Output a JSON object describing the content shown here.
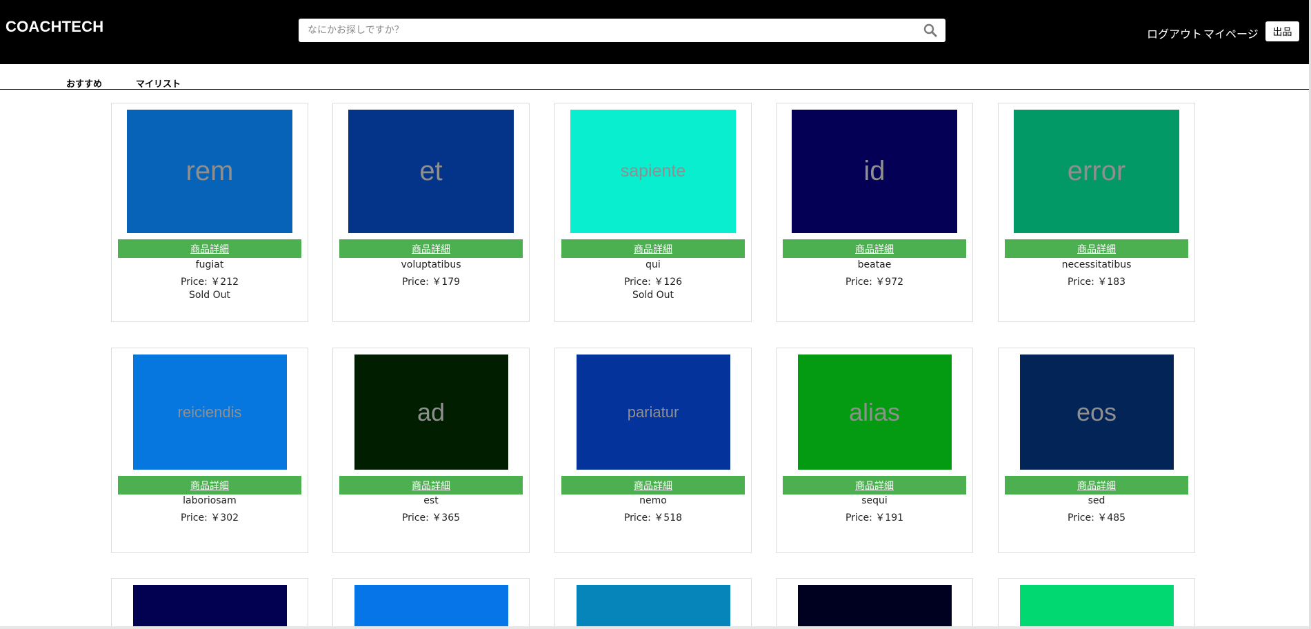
{
  "header": {
    "logo": "COACHTECH",
    "search_placeholder": "なにかお探しですか？",
    "logout": "ログアウト",
    "mypage": "マイページ",
    "post": "出品"
  },
  "tabs": [
    "おすすめ",
    "マイリスト"
  ],
  "detail_label": "商品詳細",
  "price_prefix": "Price: ￥",
  "sold_label": "Sold Out",
  "items": [
    {
      "thumb_text": "rem",
      "color": "#0663b8",
      "name": "fugiat",
      "price": "212",
      "sold": true
    },
    {
      "thumb_text": "et",
      "color": "#033489",
      "name": "voluptatibus",
      "price": "179",
      "sold": false
    },
    {
      "thumb_text": "sapiente",
      "color": "#08eecf",
      "name": "qui",
      "price": "126",
      "sold": true
    },
    {
      "thumb_text": "id",
      "color": "#030055",
      "name": "beatae",
      "price": "972",
      "sold": false
    },
    {
      "thumb_text": "error",
      "color": "#029966",
      "name": "necessitatibus",
      "price": "183",
      "sold": false
    },
    {
      "thumb_text": "reiciendis",
      "color": "#0677de",
      "name": "laboriosam",
      "price": "302",
      "sold": false
    },
    {
      "thumb_text": "ad",
      "color": "#011e00",
      "name": "est",
      "price": "365",
      "sold": false
    },
    {
      "thumb_text": "pariatur",
      "color": "#03339b",
      "name": "nemo",
      "price": "518",
      "sold": false
    },
    {
      "thumb_text": "alias",
      "color": "#049a11",
      "name": "sequi",
      "price": "191",
      "sold": false
    },
    {
      "thumb_text": "eos",
      "color": "#022456",
      "name": "sed",
      "price": "485",
      "sold": false
    },
    {
      "thumb_text": "",
      "color": "#020050",
      "name": "",
      "price": "",
      "sold": false
    },
    {
      "thumb_text": "",
      "color": "#0575e8",
      "name": "",
      "price": "",
      "sold": false
    },
    {
      "thumb_text": "",
      "color": "#0585ba",
      "name": "",
      "price": "",
      "sold": false
    },
    {
      "thumb_text": "",
      "color": "#000020",
      "name": "",
      "price": "",
      "sold": false
    },
    {
      "thumb_text": "",
      "color": "#02d872",
      "name": "",
      "price": "",
      "sold": false
    }
  ]
}
